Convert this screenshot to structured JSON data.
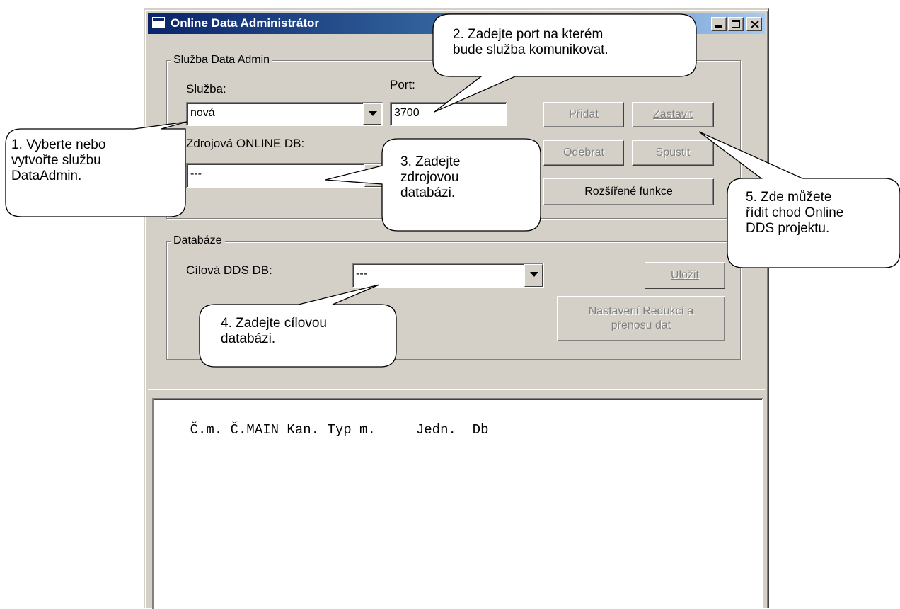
{
  "window": {
    "title": "Online Data Administrátor"
  },
  "service_group": {
    "title": "Služba Data Admin",
    "service_label": "Služba:",
    "service_value": "nová",
    "port_label": "Port:",
    "port_value": "3700",
    "source_db_label": "Zdrojová ONLINE DB:",
    "source_db_value": "---",
    "buttons": {
      "add": "Přidat",
      "stop": "Zastavit",
      "remove": "Odebrat",
      "start": "Spustit",
      "advanced": "Rozšířené funkce"
    }
  },
  "database_group": {
    "title": "Databáze",
    "target_db_label": "Cílová DDS DB:",
    "target_db_value": "---",
    "save_button": "Uložit",
    "reduction_button_line1": "Nastavení Redukcí a",
    "reduction_button_line2": "přenosu dat"
  },
  "list": {
    "header": "Č.m. Č.MAIN Kan. Typ m.     Jedn.  Db"
  },
  "callouts": {
    "c1": [
      "1. Vyberte nebo",
      "vytvořte službu",
      "DataAdmin."
    ],
    "c2": [
      "2. Zadejte port na kterém",
      "bude služba komunikovat."
    ],
    "c3": [
      "3. Zadejte",
      "zdrojovou",
      "databázi."
    ],
    "c4": [
      "4. Zadejte cílovou",
      "databázi."
    ],
    "c5": [
      "5. Zde můžete",
      "řídit chod Online",
      "DDS projektu."
    ]
  }
}
